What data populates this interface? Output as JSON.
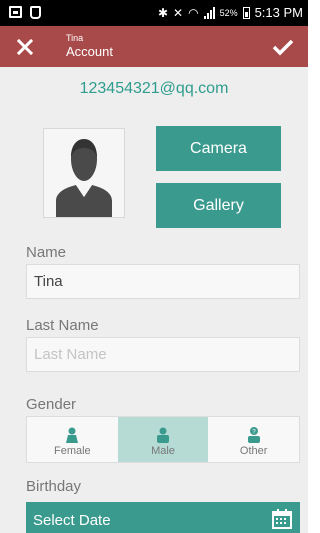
{
  "status_bar": {
    "battery": "52%",
    "time": "5:13 PM",
    "icons": [
      "screenshot-icon",
      "bbm-icon",
      "bluetooth-icon",
      "mute-icon",
      "wifi-icon",
      "signal-icon",
      "battery-icon"
    ]
  },
  "app_bar": {
    "subtitle": "Tina",
    "title": "Account",
    "color": "#a94a4a"
  },
  "email": "123454321@qq.com",
  "photo": {
    "camera_label": "Camera",
    "gallery_label": "Gallery"
  },
  "form": {
    "name_label": "Name",
    "name_value": "Tina",
    "last_name_label": "Last Name",
    "last_name_placeholder": "Last Name",
    "gender_label": "Gender",
    "gender_options": [
      "Female",
      "Male",
      "Other"
    ],
    "gender_selected": "Male",
    "birthday_label": "Birthday",
    "birthday_button": "Select Date"
  },
  "colors": {
    "accent": "#3a9a8e",
    "selected": "#b6dbd5"
  }
}
